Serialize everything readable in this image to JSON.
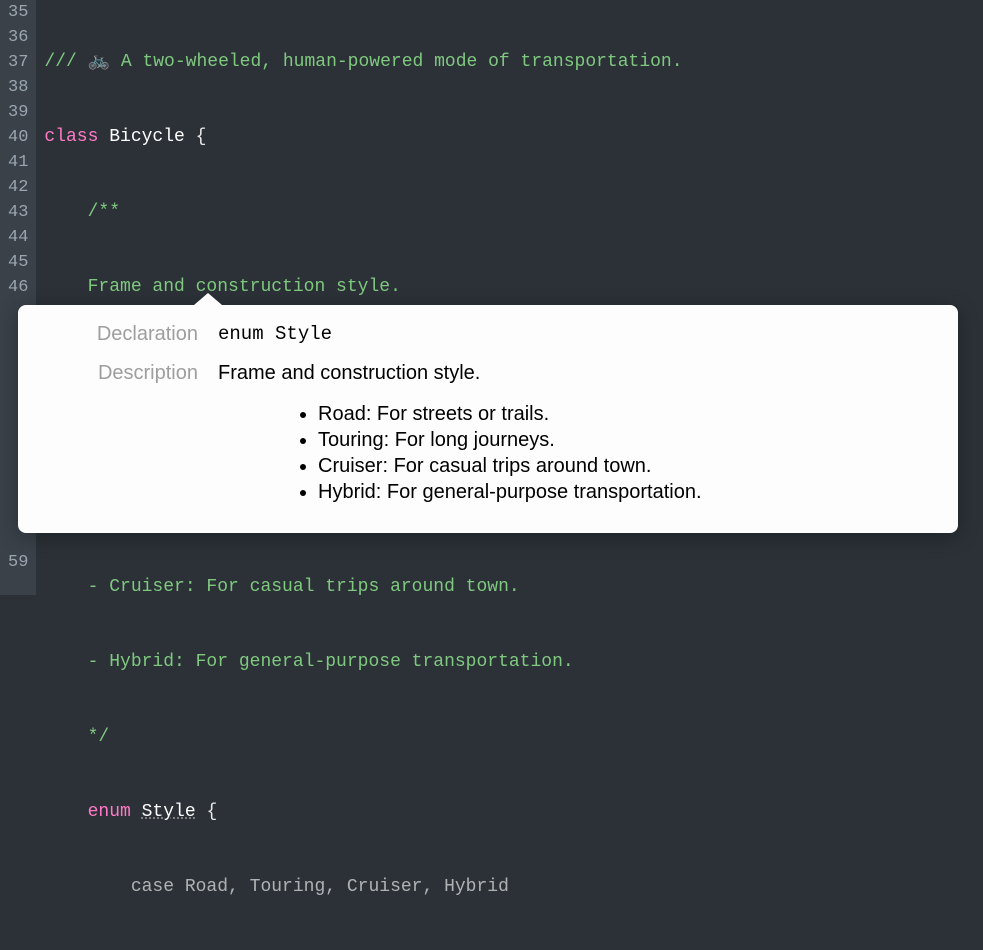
{
  "lines": {
    "numbers": [
      "35",
      "36",
      "37",
      "38",
      "39",
      "40",
      "41",
      "42",
      "43",
      "44",
      "45",
      "46"
    ],
    "l35_prefix": "/// ",
    "l35_emoji": "🚲",
    "l35_rest": " A two-wheeled, human-powered mode of transportation.",
    "l36_kw": "class",
    "l36_name": " Bicycle ",
    "l36_brace": "{",
    "l37": "    /**",
    "l38": "    Frame and construction style.",
    "l39": "",
    "l40": "    - Road: For streets or trails.",
    "l41": "    - Touring: For long journeys.",
    "l42": "    - Cruiser: For casual trips around town.",
    "l43": "    - Hybrid: For general-purpose transportation.",
    "l44": "    */",
    "l45_indent": "    ",
    "l45_kw": "enum",
    "l45_sp": " ",
    "l45_name": "Style",
    "l45_brace": " {",
    "l46_partial": "        case Road, Touring, Cruiser, Hybrid",
    "last_num": "59"
  },
  "popover": {
    "declaration_label": "Declaration",
    "declaration_value": "enum Style",
    "description_label": "Description",
    "description_value": "Frame and construction style.",
    "items": [
      "Road: For streets or trails.",
      "Touring: For long journeys.",
      "Cruiser: For casual trips around town.",
      "Hybrid: For general-purpose transportation."
    ]
  }
}
